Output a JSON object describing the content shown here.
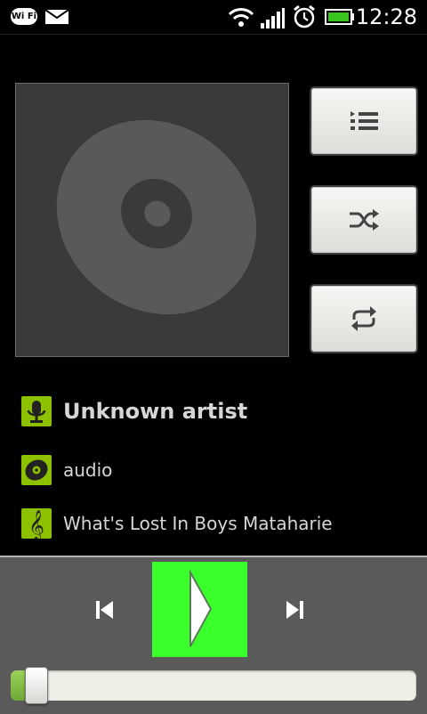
{
  "status_bar": {
    "wifi_badge": "Wi Fi",
    "time": "12:28",
    "icons": [
      "wifi-badge-icon",
      "mail-icon",
      "wifi-signal-icon",
      "cell-signal-icon",
      "alarm-clock-icon",
      "battery-icon"
    ],
    "battery_color": "#39c41f"
  },
  "album_art": {
    "icon": "cd-disc-icon"
  },
  "side_buttons": [
    {
      "name": "playlist",
      "icon": "playlist-icon"
    },
    {
      "name": "shuffle",
      "icon": "shuffle-icon"
    },
    {
      "name": "repeat",
      "icon": "repeat-icon"
    }
  ],
  "track": {
    "artist": "Unknown artist",
    "album": "audio",
    "title": "What's Lost In Boys  Mataharie",
    "icon_color": "#8dc100"
  },
  "controls": {
    "play_color": "#3bff2a",
    "icons": [
      "previous-icon",
      "play-icon",
      "next-icon"
    ],
    "progress": 0.04
  }
}
